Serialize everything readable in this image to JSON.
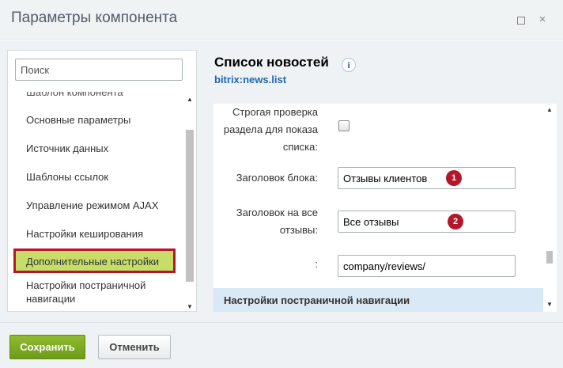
{
  "dialog": {
    "title": "Параметры компонента",
    "maximize_icon": "maximize-icon",
    "close_icon": "close-icon",
    "close_glyph": "×"
  },
  "sidebar": {
    "search_placeholder": "Поиск",
    "items": [
      {
        "label": "Шаблон компонента"
      },
      {
        "label": "Основные параметры"
      },
      {
        "label": "Источник данных"
      },
      {
        "label": "Шаблоны ссылок"
      },
      {
        "label": "Управление режимом AJAX"
      },
      {
        "label": "Настройки кеширования"
      },
      {
        "label": "Дополнительные настройки",
        "active": true
      },
      {
        "label": "Настройки постраничной навигации"
      }
    ]
  },
  "component": {
    "title": "Список новостей",
    "code": "bitrix:news.list",
    "info_glyph": "i"
  },
  "form": {
    "fields": [
      {
        "label": "Строгая проверка раздела для показа списка:",
        "type": "checkbox",
        "checked": false
      },
      {
        "label": "Заголовок блока:",
        "type": "text",
        "value": "Отзывы клиентов",
        "marker": "1"
      },
      {
        "label": "Заголовок на все отзывы:",
        "type": "text",
        "value": "Все отзывы",
        "marker": "2"
      },
      {
        "label": ":",
        "type": "text",
        "value": "company/reviews/"
      }
    ],
    "section_header": "Настройки постраничной навигации"
  },
  "footer": {
    "save_label": "Сохранить",
    "cancel_label": "Отменить"
  },
  "colors": {
    "accent_green": "#7aa81f",
    "active_item_bg": "#c6dd68",
    "highlight_border": "#b4162a",
    "link_blue": "#2067b0",
    "section_bg": "#d9e9f5"
  }
}
